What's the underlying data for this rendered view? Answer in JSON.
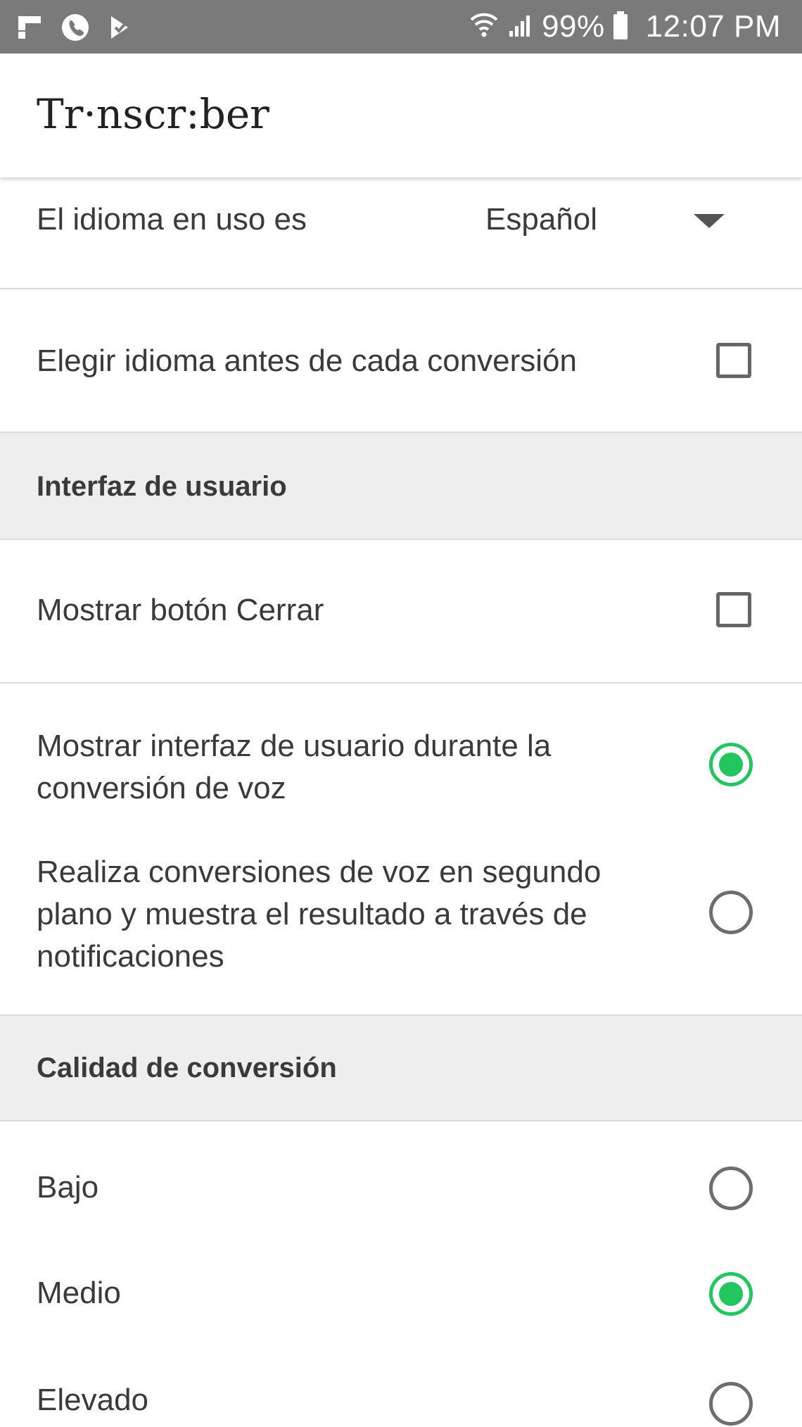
{
  "status_bar": {
    "battery": "99%",
    "time": "12:07 PM",
    "left_icons": [
      "flipboard-icon",
      "phone-icon",
      "check-icon"
    ],
    "right_icons": [
      "wifi-icon",
      "signal-icon",
      "battery-icon"
    ]
  },
  "app": {
    "title": "Tr·nscr:ber"
  },
  "language": {
    "label": "El idioma en uso es",
    "value": "Español"
  },
  "choose_language": {
    "label": "Elegir idioma antes de cada conversión",
    "checked": false
  },
  "section_ui": {
    "header": "Interfaz de usuario",
    "close_button_label": "Mostrar botón Cerrar",
    "close_button_checked": false,
    "option_show_ui": "Mostrar interfaz de usuario durante la conversión de voz",
    "option_background": "Realiza conversiones de voz en segundo plano y muestra el resultado a través de notificaciones",
    "selected": "show_ui"
  },
  "section_quality": {
    "header": "Calidad de conversión",
    "options": [
      "Bajo",
      "Medio",
      "Elevado"
    ],
    "selected": "Medio"
  },
  "colors": {
    "accent": "#22c55e",
    "status_bar": "#7a7a7a",
    "section_header_bg": "#eeeeee"
  }
}
